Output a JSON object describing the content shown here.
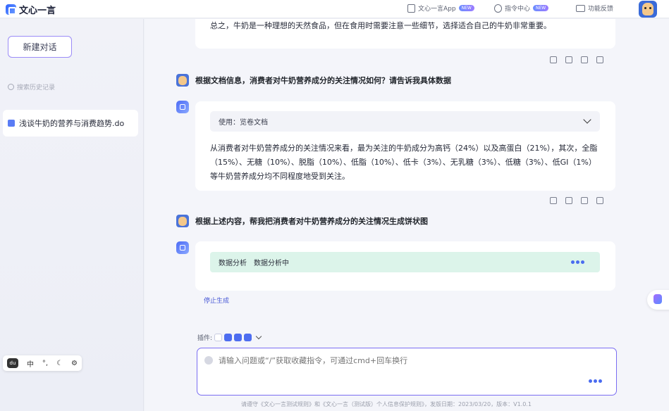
{
  "app": {
    "name": "文心一言"
  },
  "topnav": {
    "app_label": "文心一言App",
    "cmd_label": "指令中心",
    "new_badge": "NEW",
    "feedback_label": "功能反馈"
  },
  "sidebar": {
    "new_chat": "新建对话",
    "search_placeholder": "搜索历史记录",
    "history": [
      {
        "label": "浅谈牛奶的营养与消费趋势.do"
      }
    ],
    "toolbox": {
      "lang": "中"
    }
  },
  "chat": {
    "top_message": "总之，牛奶是一种理想的天然食品，但在食用时需要注意一些细节，选择适合自己的牛奶非常重要。",
    "user_q1": "根据文档信息，消费者对牛奶营养成分的关注情况如何？请告诉我具体数据",
    "doc_tool": "使用：览卷文档",
    "answer1": "从消费者对牛奶营养成分的关注情况来看，最为关注的牛奶成分为高钙（24%）以及高蛋白（21%），其次，全脂（15%）、无糖（10%）、脱脂（10%）、低脂（10%）、低卡（3%）、无乳糖（3%）、低糖（3%）、低GI（1%）等牛奶营养成分均不同程度地受到关注。",
    "user_q2": "根据上述内容，帮我把消费者对牛奶营养成分的关注情况生成饼状图",
    "analysis_tool": "数据分析",
    "analysis_status": "数据分析中",
    "stop_label": "停止生成"
  },
  "composer": {
    "plugins_label": "插件:",
    "placeholder": "请输入问题或“/”获取收藏指令，可通过cmd+回车换行"
  },
  "footer": "请遵守《文心一言测试规则》和《文心一言（测试版）个人信息保护规则》，发版日期：2023/03/20，版本：V1.0.1"
}
